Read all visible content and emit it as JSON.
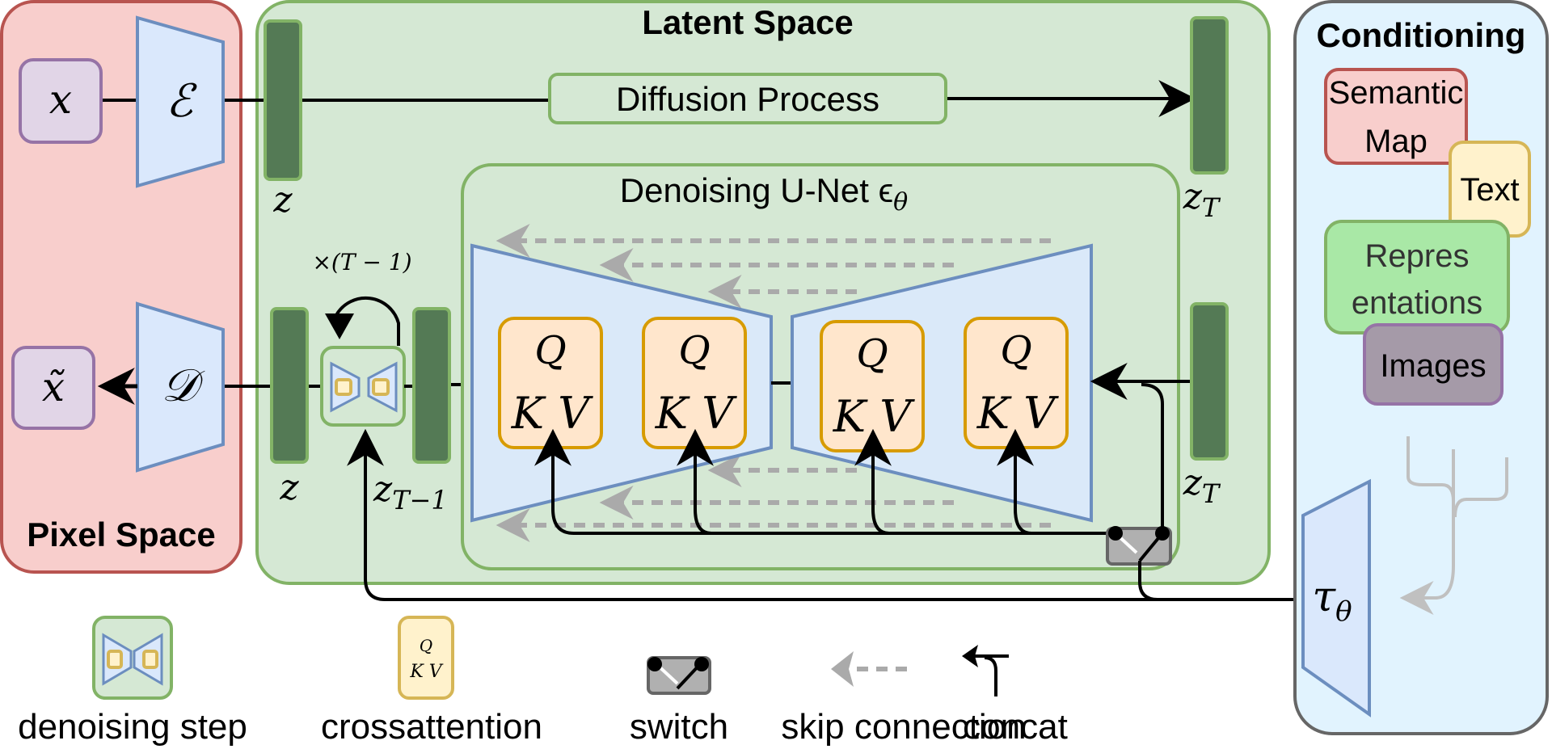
{
  "regions": {
    "pixel_space": {
      "title": "Pixel Space",
      "fill": "#f8cecc",
      "stroke": "#b85450"
    },
    "latent_space": {
      "title": "Latent Space",
      "fill": "#d5e8d4",
      "stroke": "#82b366"
    },
    "conditioning": {
      "title": "Conditioning",
      "fill": "#e1f3fe",
      "stroke": "#666666"
    }
  },
  "pixel": {
    "input_label": "x",
    "output_label": "x̃",
    "encoder_label": "ℰ",
    "decoder_label": "𝒟"
  },
  "latent": {
    "diffusion_process": "Diffusion Process",
    "z_top": "z",
    "z_bottom": "z",
    "zT_top": "z",
    "zT_top_sub": "T",
    "zT_bottom": "z",
    "zT_bottom_sub": "T",
    "zT1": "z",
    "zT1_sub": "T−1",
    "loop_label": "×(T − 1)",
    "unet_title": "Denoising U-Net ϵ",
    "unet_title_sub": "θ"
  },
  "crossattention_blocks": [
    {
      "q": "Q",
      "kv": "K V"
    },
    {
      "q": "Q",
      "kv": "K V"
    },
    {
      "q": "Q",
      "kv": "K V"
    },
    {
      "q": "Q",
      "kv": "K V"
    }
  ],
  "conditioning": {
    "items": [
      {
        "label_line1": "Semantic",
        "label_line2": "Map",
        "fill": "#f8cecc",
        "stroke": "#b85450"
      },
      {
        "label_line1": "Text",
        "label_line2": "",
        "fill": "#fff2cc",
        "stroke": "#d6b656"
      },
      {
        "label_line1": "Repres",
        "label_line2": "entations",
        "fill": "#a9e8a6",
        "stroke": "#82b366"
      },
      {
        "label_line1": "Images",
        "label_line2": "",
        "fill": "#a59aa8",
        "stroke": "#9673a6"
      }
    ],
    "tau_label": "τ",
    "tau_sub": "θ"
  },
  "legend": [
    {
      "label": "denoising step",
      "icon": "denoising-step-icon"
    },
    {
      "label": "crossattention",
      "icon": "crossattention-icon"
    },
    {
      "label": "switch",
      "icon": "switch-icon"
    },
    {
      "label": "skip connection",
      "icon": "skip-connection-icon"
    },
    {
      "label": "concat",
      "icon": "concat-icon"
    }
  ],
  "legend_qkv": {
    "q": "Q",
    "kv": "K V"
  },
  "colors": {
    "latent_bar": "#547a55",
    "trapezoid_fill": "#dae8fc",
    "trapezoid_stroke": "#6c8ebf",
    "purple_fill": "#e1d5e7",
    "purple_stroke": "#9673a6",
    "qkv_fill": "#ffe6cc",
    "qkv_stroke": "#d79b00",
    "skip_gray": "#aaaaaa"
  }
}
